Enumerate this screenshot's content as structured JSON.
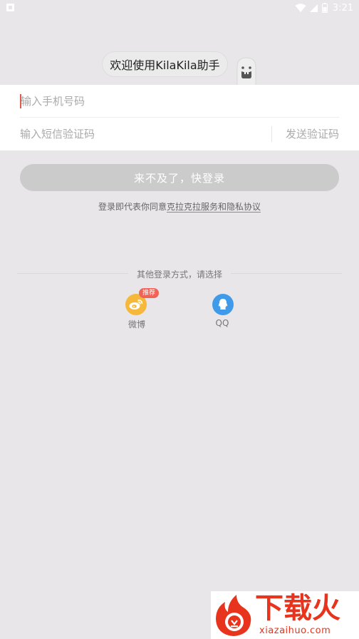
{
  "status_bar": {
    "time": "3:21"
  },
  "welcome": {
    "text": "欢迎使用KilaKila助手"
  },
  "form": {
    "phone_placeholder": "输入手机号码",
    "code_placeholder": "输入短信验证码",
    "send_code_label": "发送验证码"
  },
  "login_button": {
    "label": "来不及了，快登录"
  },
  "agreement": {
    "prefix": "登录即代表你同意",
    "link": "克拉克拉服务和隐私协议"
  },
  "other_login": {
    "title": "其他登录方式，请选择",
    "weibo": {
      "label": "微博",
      "badge": "推荐"
    },
    "qq": {
      "label": "QQ"
    }
  },
  "watermark": {
    "main": "下载火",
    "sub": "xiazaihuo.com"
  },
  "colors": {
    "background": "#e8e6e8",
    "login_button": "#cbcbcb",
    "weibo": "#f5b83a",
    "qq": "#3f9bea",
    "badge": "#f06458",
    "cursor": "#e05a4f"
  }
}
